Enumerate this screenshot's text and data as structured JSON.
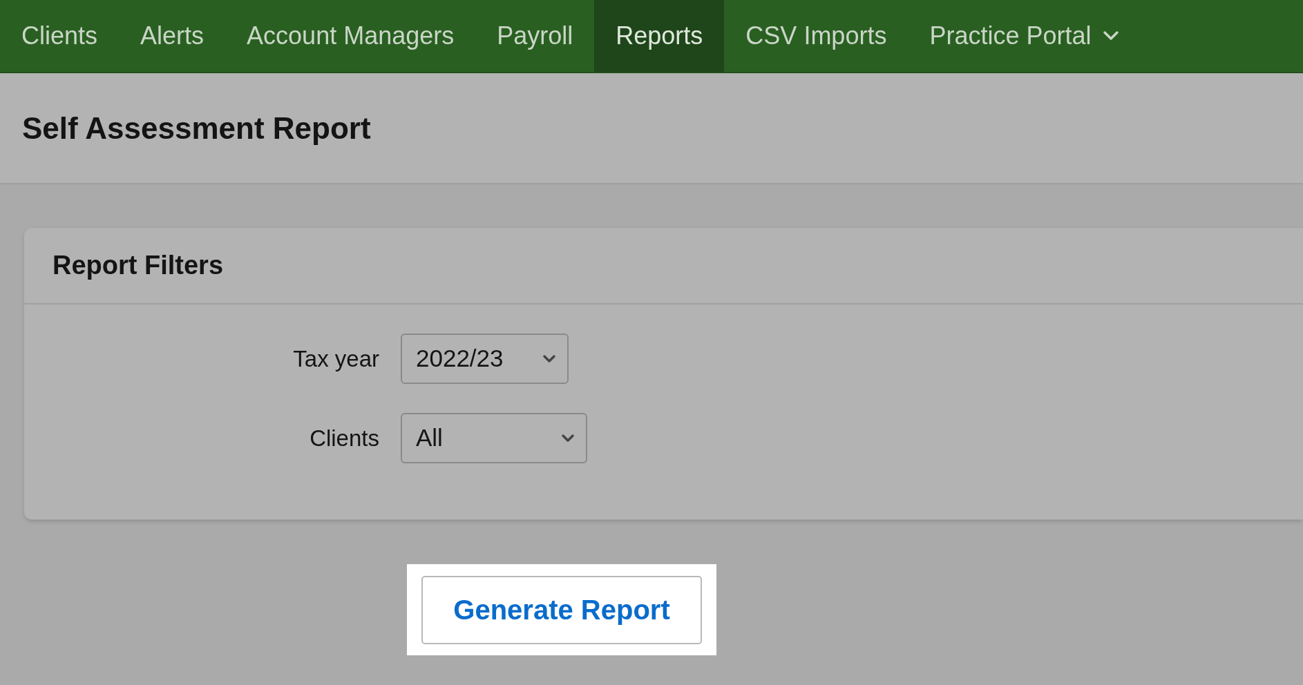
{
  "nav": {
    "tabs": [
      {
        "label": "Clients",
        "selected": false
      },
      {
        "label": "Alerts",
        "selected": false
      },
      {
        "label": "Account Managers",
        "selected": false
      },
      {
        "label": "Payroll",
        "selected": false
      },
      {
        "label": "Reports",
        "selected": true
      },
      {
        "label": "CSV Imports",
        "selected": false
      },
      {
        "label": "Practice Portal",
        "selected": false,
        "kind": "dropdown"
      }
    ]
  },
  "page": {
    "title": "Self Assessment Report"
  },
  "filters": {
    "title": "Report Filters",
    "fields": [
      {
        "label": "Tax year",
        "value": "2022/23"
      },
      {
        "label": "Clients",
        "value": "All"
      }
    ]
  },
  "generate_button": {
    "label": "Generate Report"
  }
}
